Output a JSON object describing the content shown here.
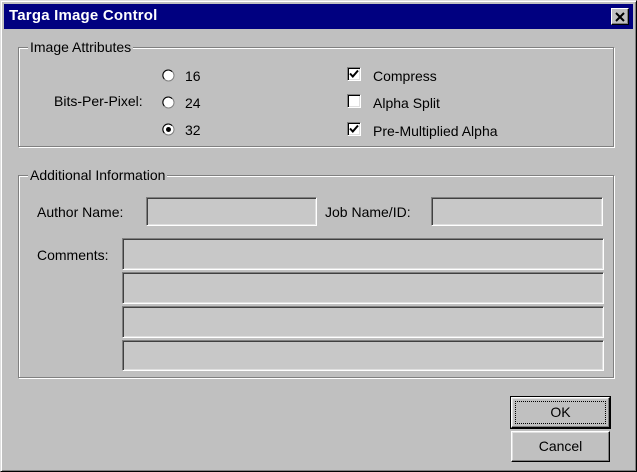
{
  "window": {
    "title": "Targa Image Control"
  },
  "image_attributes": {
    "label": "Image Attributes",
    "bpp_label": "Bits-Per-Pixel:",
    "options": [
      {
        "label": "16",
        "selected": false
      },
      {
        "label": "24",
        "selected": false
      },
      {
        "label": "32",
        "selected": true
      }
    ],
    "checks": [
      {
        "label": "Compress",
        "checked": true
      },
      {
        "label": "Alpha Split",
        "checked": false
      },
      {
        "label": "Pre-Multiplied Alpha",
        "checked": true
      }
    ]
  },
  "additional_info": {
    "label": "Additional Information",
    "author_label": "Author Name:",
    "author_value": "",
    "job_label": "Job Name/ID:",
    "job_value": "",
    "comments_label": "Comments:",
    "comments": [
      "",
      "",
      "",
      ""
    ]
  },
  "buttons": {
    "ok": "OK",
    "cancel": "Cancel"
  }
}
